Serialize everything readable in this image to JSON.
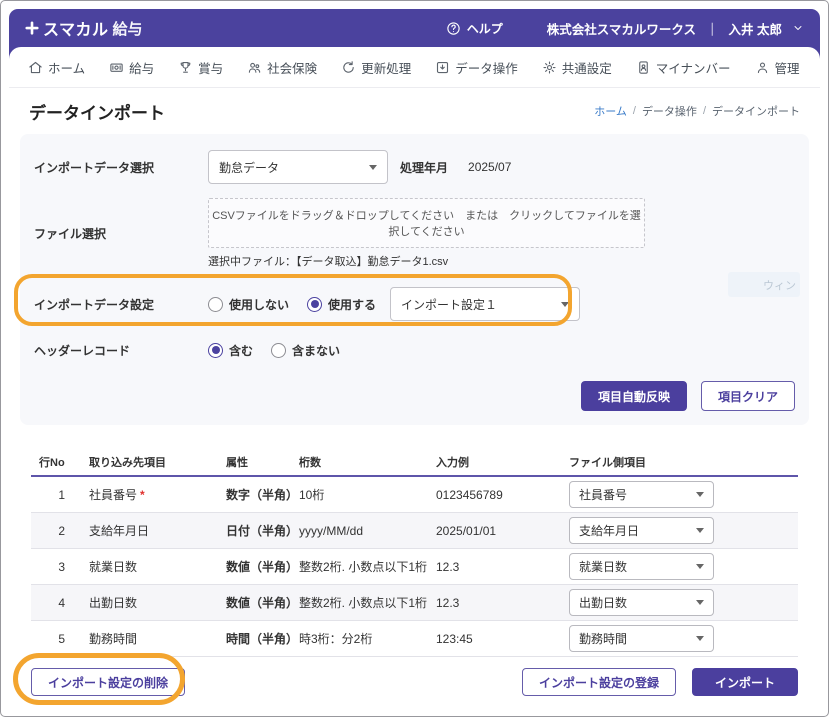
{
  "header": {
    "logo_brand": "スマカル",
    "logo_suffix": "給与",
    "help_label": "ヘルプ",
    "company": "株式会社スマカルワークス",
    "divider": "｜",
    "user": "入井 太郎"
  },
  "nav": {
    "items": [
      {
        "label": "ホーム",
        "icon": "home-icon"
      },
      {
        "label": "給与",
        "icon": "payroll-icon"
      },
      {
        "label": "賞与",
        "icon": "bonus-icon"
      },
      {
        "label": "社会保険",
        "icon": "social-insurance-icon"
      },
      {
        "label": "更新処理",
        "icon": "refresh-icon"
      },
      {
        "label": "データ操作",
        "icon": "data-operation-icon"
      },
      {
        "label": "共通設定",
        "icon": "gear-icon"
      },
      {
        "label": "マイナンバー",
        "icon": "mynumber-card-icon"
      },
      {
        "label": "管理",
        "icon": "admin-person-icon"
      }
    ]
  },
  "page": {
    "title": "データインポート",
    "breadcrumb": {
      "home": "ホーム",
      "sep": "/",
      "section": "データ操作",
      "current": "データインポート"
    }
  },
  "form": {
    "import_select": {
      "label": "インポートデータ選択",
      "value": "勤怠データ"
    },
    "processing_month": {
      "label": "処理年月",
      "value": "2025/07"
    },
    "file_select": {
      "label": "ファイル選択",
      "dropzone_text": "CSVファイルをドラッグ＆ドロップしてください　または　クリックしてファイルを選択してください",
      "selected_file": "選択中ファイル：【データ取込】勤怠データ1.csv"
    },
    "import_setting": {
      "label": "インポートデータ設定",
      "option_no": "使用しない",
      "option_yes": "使用する",
      "selected": "使用する",
      "dropdown_value": "インポート設定１"
    },
    "header_record": {
      "label": "ヘッダーレコード",
      "option_include": "含む",
      "option_exclude": "含まない",
      "selected": "含む"
    },
    "auto_reflect_button": "項目自動反映",
    "clear_button": "項目クリア"
  },
  "table": {
    "headers": [
      "行No",
      "取り込み先項目",
      "属性",
      "桁数",
      "入力例",
      "ファイル側項目"
    ],
    "rows": [
      {
        "no": "1",
        "item": "社員番号",
        "required_mark": "*",
        "attr": "数字（半角）",
        "digits": "10桁",
        "example": "0123456789",
        "file_item": "社員番号"
      },
      {
        "no": "2",
        "item": "支給年月日",
        "required_mark": "",
        "attr": "日付（半角）",
        "digits": "yyyy/MM/dd",
        "example": "2025/01/01",
        "file_item": "支給年月日"
      },
      {
        "no": "3",
        "item": "就業日数",
        "required_mark": "",
        "attr": "数値（半角）",
        "digits": "整数2桁. 小数点以下1桁",
        "example": "12.3",
        "file_item": "就業日数"
      },
      {
        "no": "4",
        "item": "出勤日数",
        "required_mark": "",
        "attr": "数値（半角）",
        "digits": "整数2桁. 小数点以下1桁",
        "example": "12.3",
        "file_item": "出勤日数"
      },
      {
        "no": "5",
        "item": "勤務時間",
        "required_mark": "",
        "attr": "時間（半角）",
        "digits": "時3桁：分2桁",
        "example": "123:45",
        "file_item": "勤務時間"
      }
    ]
  },
  "footer": {
    "delete_button": "インポート設定の削除",
    "register_button": "インポート設定の登録",
    "import_button": "インポート"
  },
  "misc": {
    "faint_tooltip": "ウィン"
  },
  "colors": {
    "primary_purple": "#4b429e",
    "annotation_orange": "#f3a52f",
    "link_blue": "#3a7bc8",
    "required_red": "#e0312e"
  }
}
